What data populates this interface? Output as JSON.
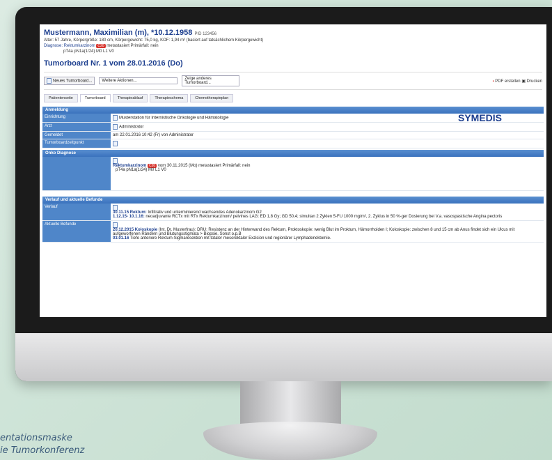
{
  "patient": {
    "name": "Mustermann, Maximilian (m), *10.12.1958",
    "pid": "PID 123456",
    "meta": "Alter: 57 Jahre, Körpergröße: 180 cm, Körpergewicht: 75,0 kg, KOF: 1,94 m² (basiert auf tatsächlichem Körpergewicht)",
    "diagnosis_label": "Diagnose: Rektumkarzinom",
    "diagnosis_badge": "C20",
    "diagnosis_rest": "metastasiert  Primärfall: nein",
    "tnm": "pT4a pN1a(1/24) M0 L1 V0"
  },
  "board": {
    "title": "Tumorboard  Nr. 1 vom 28.01.2016 (Do)"
  },
  "toolbar": {
    "new_board": "Neues Tumorboard...",
    "more_actions": "Weitere Aktionen...",
    "other_board": "Zeige anderes Tumorboard...",
    "pdf": "PDF erstellen",
    "print": "Drucken"
  },
  "tabs": [
    "Patientenseite",
    "Tumorboard",
    "Therapieablauf",
    "Therapieschema",
    "Chemotherapieplan"
  ],
  "sections": {
    "anmeldung": {
      "title": "Anmeldung",
      "einrichtung_label": "Einrichtung",
      "einrichtung": "Musterstation für Internistische Onkologie und Hämatologie",
      "arzt_label": "Arzt",
      "arzt": "Administrator",
      "gemeldet_label": "Gemeldet",
      "gemeldet": "am 22.01.2016 10:42 (Fr) von   Administrator",
      "zeitpunkt_label": "Tumorboardzeitpunkt"
    },
    "diagnose": {
      "title": "Onko Diagnose",
      "name": "Rektumkarzinom",
      "badge": "C20",
      "rest": "vom 30.11.2015 (Mo)  metastasiert  Primärfall: nein",
      "tnm": "pT4a pN1a(1/24) M0 L1 V0"
    },
    "verlauf": {
      "title": "Verlauf und aktuelle Befunde",
      "verlauf_label": "Verlauf",
      "v1_date": "30.11.15 Rektum:",
      "v1": "Infiltrativ und unterminierend wachsendes Adenokarzinom G2",
      "v2_date": "1.12.15- 10.1.16:",
      "v2": "neoadjuvante RCTx mit RTx Rektumkarzinom/ pelvines LAG: ED 1,8 Gy; GD 50,4; simultan 2 Zyklen 5-FU 1000 mg/m², 2. Zyklus in 50 %-ger Dosierung bei V.a. vasospastische Angina pectoris",
      "befunde_label": "Aktuelle Befunde",
      "b1_date": "20.12.2015 Koloskopie",
      "b1": "(Int.  Dr. Musterfrau): DRU: Resistenz an der Hinterwand des Rektum, Proktoskopie: wenig Blut im Proktum, Hämorrhoiden I; Koloskopie: zwischen 8 und 15 cm ab Anus findet sich ein Ulcus mit aufgeworfenen Rändern und Blutungsstigmata > Biopsie. Sonst o.p.B",
      "b2_date": "03.01.16",
      "b2": "Tiefe anteriore Rektum-Sigmaresektion mit totaler mesorektaler Exzision und regionärer Lymphadenektomie."
    }
  },
  "brand": "SYMEDIS",
  "caption": {
    "line1": "entationsmaske",
    "line2": "ie Tumorkonferenz"
  }
}
